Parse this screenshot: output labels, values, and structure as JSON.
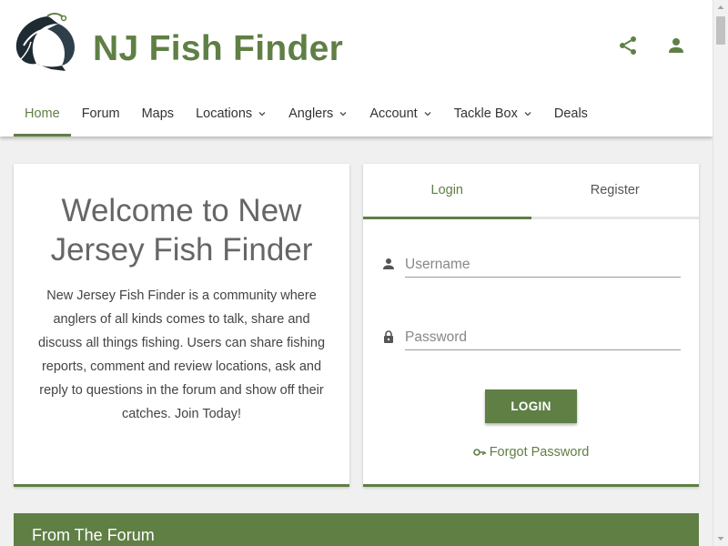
{
  "site": {
    "title": "NJ Fish Finder",
    "brand_color": "#5f7f45",
    "logo_icon": "fish-hook-logo"
  },
  "header_icons": [
    {
      "name": "share-icon"
    },
    {
      "name": "account-icon"
    }
  ],
  "nav": {
    "home": "Home",
    "forum": "Forum",
    "maps": "Maps",
    "locations": "Locations",
    "anglers": "Anglers",
    "account": "Account",
    "tackle_box": "Tackle Box",
    "deals": "Deals"
  },
  "welcome": {
    "heading": "Welcome to New Jersey Fish Finder",
    "body": "New Jersey Fish Finder is a community where anglers of all kinds comes to talk, share and discuss all things fishing. Users can share fishing reports, comment and review locations, ask and reply to questions in the forum and show off their catches. Join Today!"
  },
  "login": {
    "tab_login": "Login",
    "tab_register": "Register",
    "username_placeholder": "Username",
    "password_placeholder": "Password",
    "button": "LOGIN",
    "forgot": "Forgot Password"
  },
  "forum": {
    "heading": "From The Forum"
  }
}
